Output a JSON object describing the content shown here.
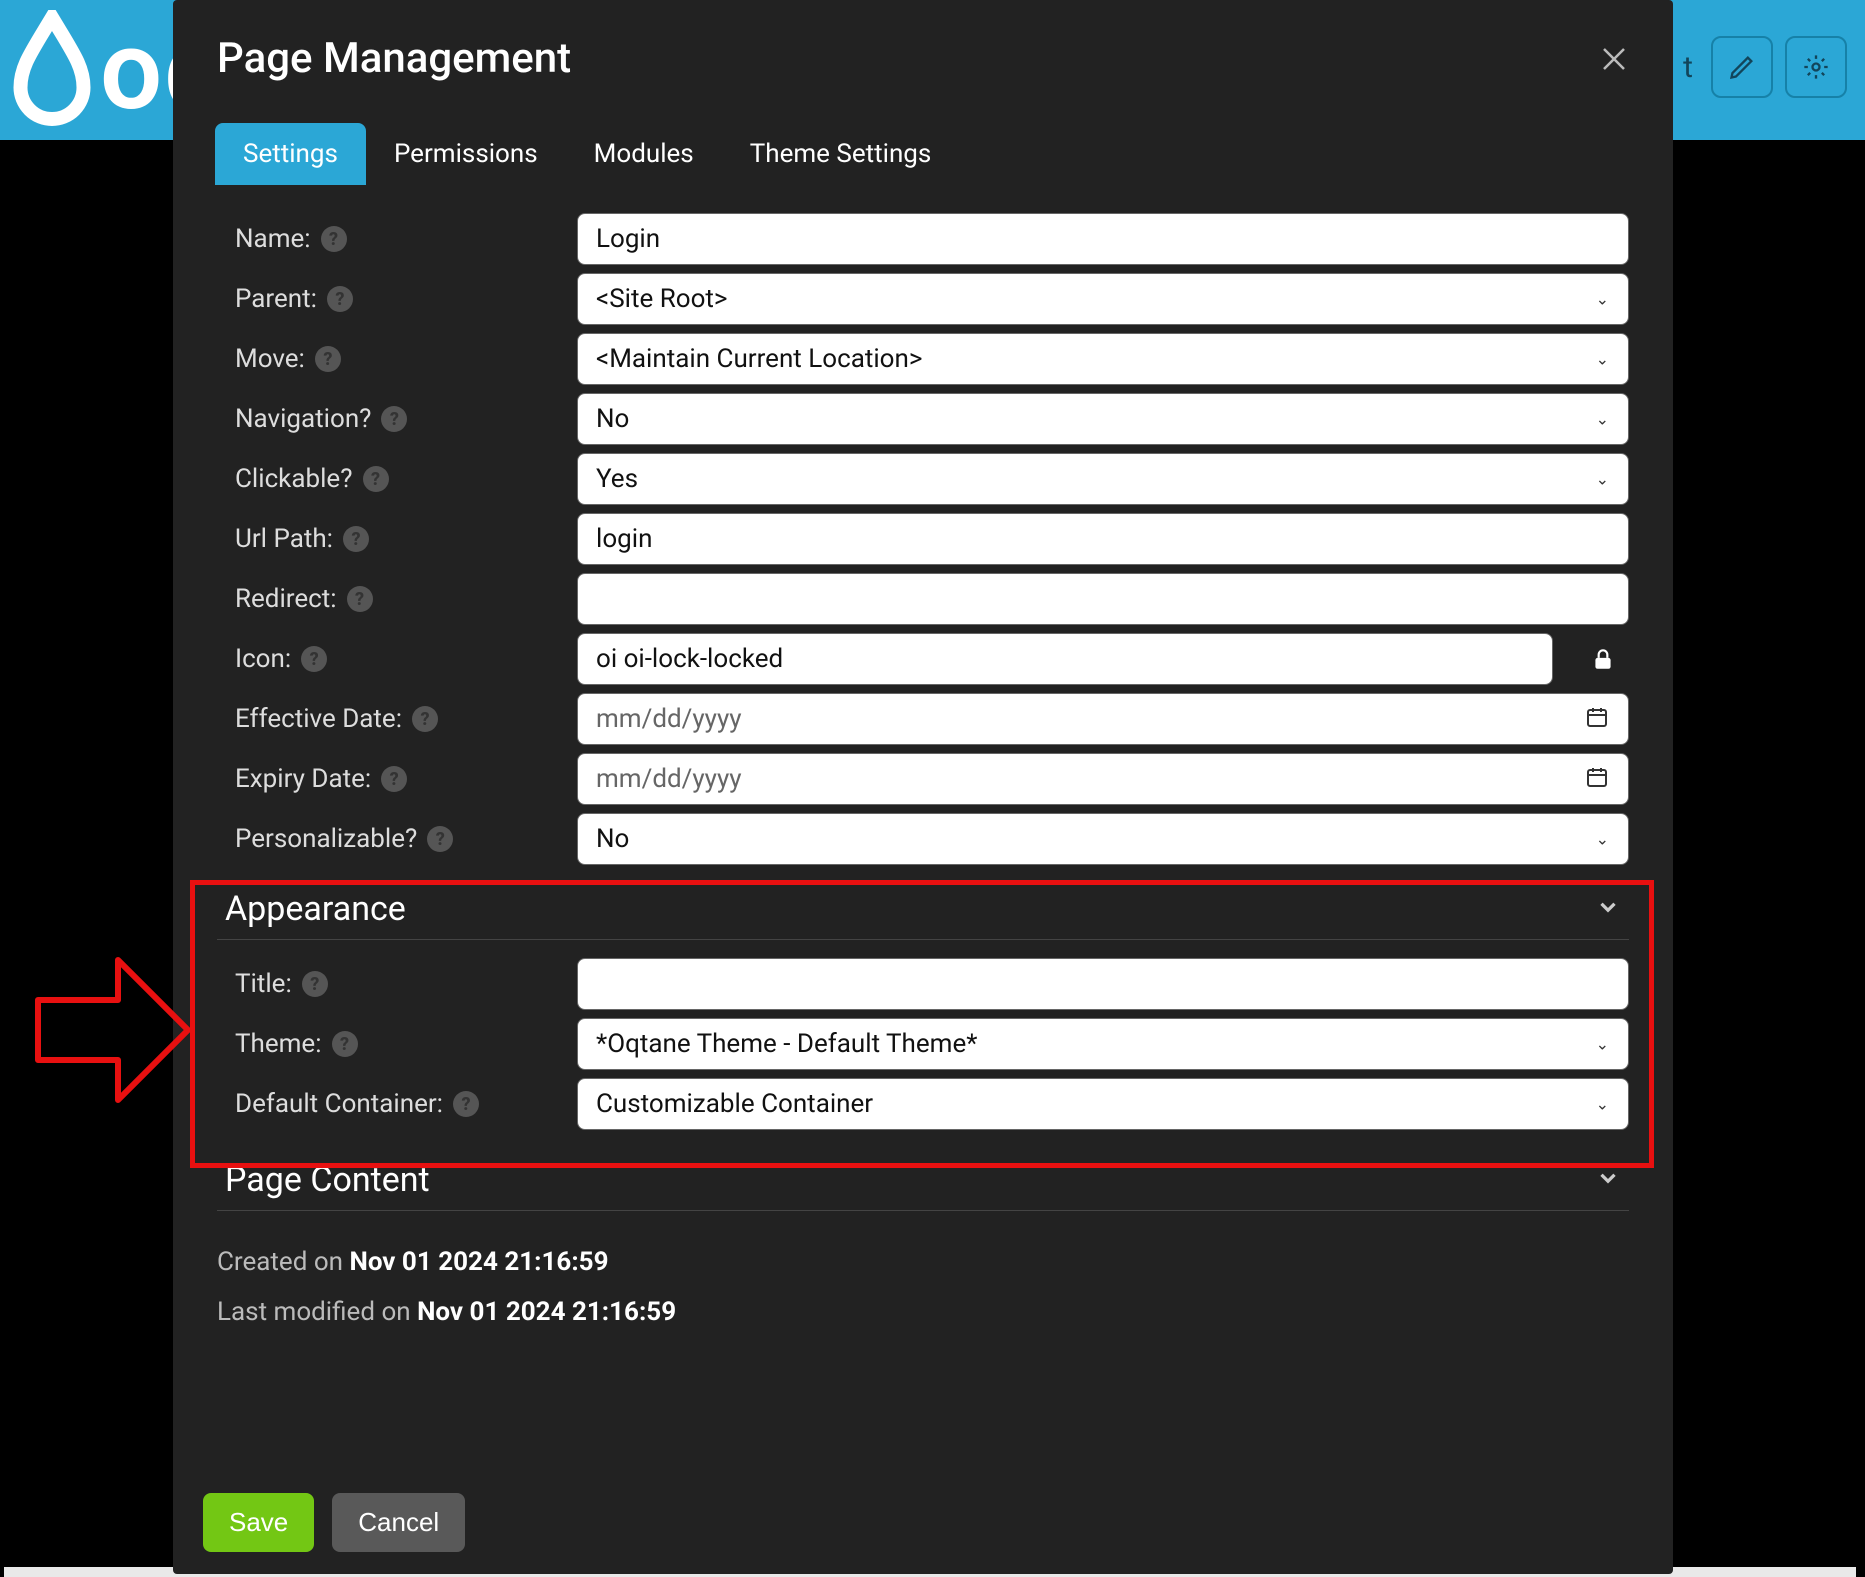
{
  "topbar": {
    "logo_text": "oq",
    "right_text": "t"
  },
  "modal": {
    "title": "Page Management"
  },
  "tabs": [
    {
      "label": "Settings",
      "active": true
    },
    {
      "label": "Permissions",
      "active": false
    },
    {
      "label": "Modules",
      "active": false
    },
    {
      "label": "Theme Settings",
      "active": false
    }
  ],
  "fields": {
    "name": {
      "label": "Name:",
      "value": "Login"
    },
    "parent": {
      "label": "Parent:",
      "value": "<Site Root>"
    },
    "move": {
      "label": "Move:",
      "value": "<Maintain Current Location>"
    },
    "navigation": {
      "label": "Navigation?",
      "value": "No"
    },
    "clickable": {
      "label": "Clickable?",
      "value": "Yes"
    },
    "url_path": {
      "label": "Url Path:",
      "value": "login"
    },
    "redirect": {
      "label": "Redirect:",
      "value": ""
    },
    "icon": {
      "label": "Icon:",
      "value": "oi oi-lock-locked"
    },
    "effective": {
      "label": "Effective Date:",
      "value": "",
      "placeholder": "mm/dd/yyyy"
    },
    "expiry": {
      "label": "Expiry Date:",
      "value": "",
      "placeholder": "mm/dd/yyyy"
    },
    "personalizable": {
      "label": "Personalizable?",
      "value": "No"
    }
  },
  "appearance": {
    "header": "Appearance",
    "title": {
      "label": "Title:",
      "value": ""
    },
    "theme": {
      "label": "Theme:",
      "value": "*Oqtane Theme - Default Theme*"
    },
    "container": {
      "label": "Default Container:",
      "value": "Customizable Container"
    }
  },
  "page_content": {
    "header": "Page Content"
  },
  "meta": {
    "created_prefix": "Created on ",
    "created_value": "Nov 01 2024 21:16:59",
    "modified_prefix": "Last modified on ",
    "modified_value": "Nov 01 2024 21:16:59"
  },
  "buttons": {
    "save": "Save",
    "cancel": "Cancel"
  }
}
